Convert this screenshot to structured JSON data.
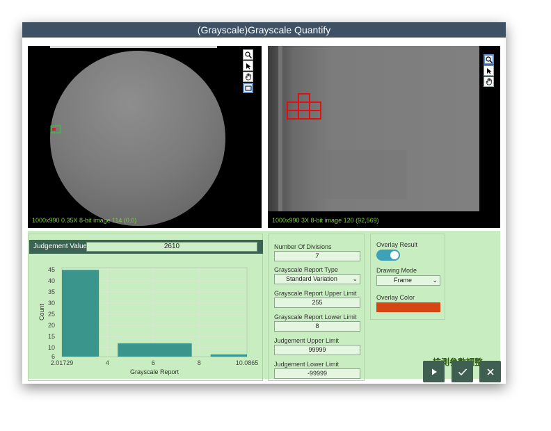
{
  "window": {
    "title": "(Grayscale)Grayscale Quantify"
  },
  "viewers": {
    "left": {
      "status": "1000x990 0.35X 8-bit image 114    (0,0)"
    },
    "right": {
      "status": "1000x990 3X 8-bit image 120    (92,569)"
    }
  },
  "judgement": {
    "label": "Judgement Value",
    "value": "2610"
  },
  "histogram": {
    "chart_data": {
      "type": "bar",
      "xlabel": "Grayscale Report",
      "ylabel": "Count",
      "x_ticks": [
        "2.01729",
        "4",
        "6",
        "8",
        "10.0865"
      ],
      "y_ticks": [
        "6",
        "10",
        "15",
        "20",
        "25",
        "30",
        "35",
        "40",
        "45"
      ],
      "xlim": [
        2.01729,
        10.0865
      ],
      "ylim": [
        6,
        46
      ],
      "grid": true,
      "bar_color": "#3a968c",
      "bins": [
        {
          "x0": 2.01729,
          "x1": 3.63,
          "count": 45
        },
        {
          "x0": 4.45,
          "x1": 7.68,
          "count": 12
        },
        {
          "x0": 8.5,
          "x1": 10.0865,
          "count": 7
        }
      ]
    }
  },
  "params": {
    "divisions_label": "Number Of Divisions",
    "divisions_value": "7",
    "report_type_label": "Grayscale Report Type",
    "report_type_value": "Standard Variation",
    "upper_limit_label": "Grayscale Report Upper Limit",
    "upper_limit_value": "255",
    "lower_limit_label": "Grayscale Report Lower Limit",
    "lower_limit_value": "8",
    "judge_upper_label": "Judgement Upper Limit",
    "judge_upper_value": "99999",
    "judge_lower_label": "Judgement Lower Limit",
    "judge_lower_value": "-99999"
  },
  "overlay": {
    "result_label": "Overlay Result",
    "result_on": true,
    "mode_label": "Drawing Mode",
    "mode_value": "Frame",
    "color_label": "Overlay Color",
    "color_value": "#d64615"
  },
  "caption": "檢測參數調整",
  "icons": {
    "zoom": "magnifier-icon",
    "select": "pointer-icon",
    "pan": "hand-icon",
    "roi": "rectangle-icon",
    "run": "play-icon",
    "ok": "check-icon",
    "cancel": "close-icon"
  }
}
